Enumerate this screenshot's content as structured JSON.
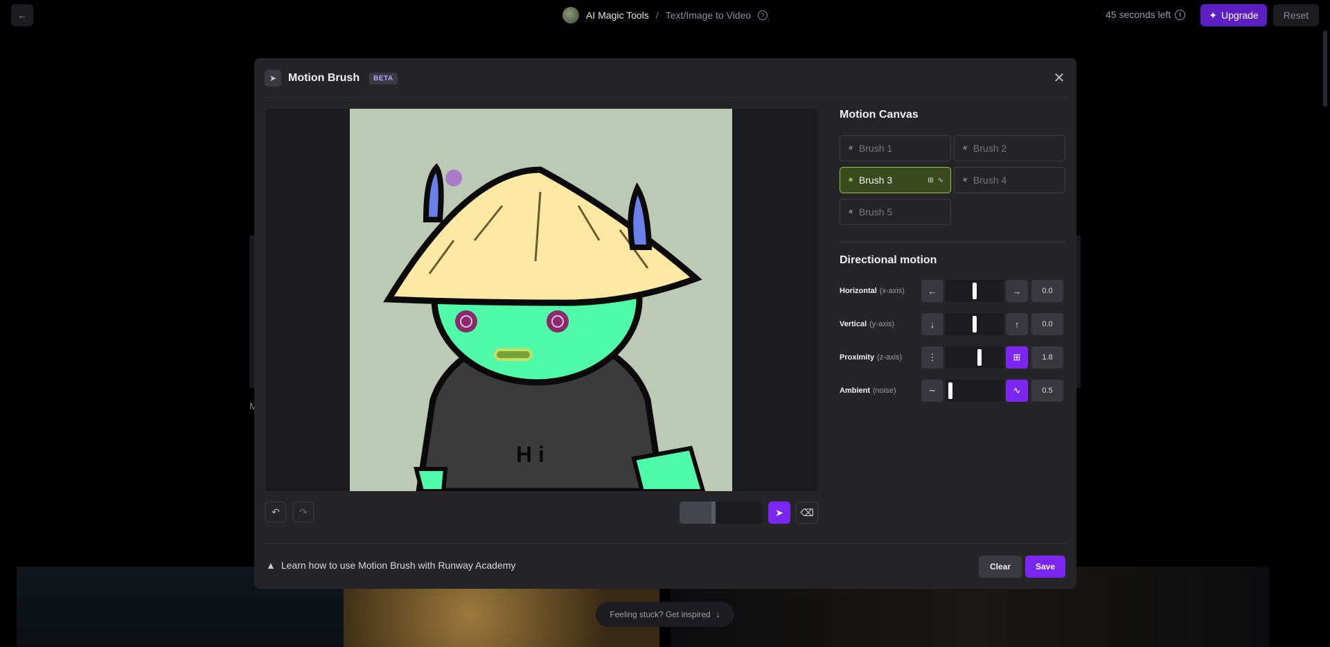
{
  "topbar": {
    "back_icon": "arrow-left-icon",
    "breadcrumb_app": "AI Magic Tools",
    "breadcrumb_sep": "/",
    "breadcrumb_page": "Text/Image to Video",
    "time_left": "45 seconds left",
    "upgrade_label": "Upgrade",
    "reset_label": "Reset"
  },
  "background": {
    "inspire_label": "Feeling stuck? Get inspired",
    "partial_letter": "M"
  },
  "modal": {
    "title": "Motion Brush",
    "badge": "BETA",
    "close_icon": "close-icon"
  },
  "motion_canvas": {
    "title": "Motion Canvas",
    "brushes": [
      {
        "label": "Brush 1",
        "active": false
      },
      {
        "label": "Brush 2",
        "active": false
      },
      {
        "label": "Brush 3",
        "active": true
      },
      {
        "label": "Brush 4",
        "active": false
      },
      {
        "label": "Brush 5",
        "active": false
      }
    ],
    "brush_size_fraction": 0.38
  },
  "directional_motion": {
    "title": "Directional motion",
    "rows": [
      {
        "label": "Horizontal",
        "sub": "(x-axis)",
        "left_icon": "arrow-left-icon",
        "right_icon": "arrow-right-icon",
        "value": "0.0",
        "level": 0.5,
        "right_accent": false
      },
      {
        "label": "Vertical",
        "sub": "(y-axis)",
        "left_icon": "arrow-down-icon",
        "right_icon": "arrow-up-icon",
        "value": "0.0",
        "level": 0.5,
        "right_accent": false
      },
      {
        "label": "Proximity",
        "sub": "(z-axis)",
        "left_icon": "proximity-far-icon",
        "right_icon": "proximity-near-icon",
        "value": "1.8",
        "level": 0.59,
        "right_accent": true
      },
      {
        "label": "Ambient",
        "sub": "(noise)",
        "left_icon": "wave-low-icon",
        "right_icon": "wave-high-icon",
        "value": "0.5",
        "level": 0.05,
        "right_accent": true
      }
    ]
  },
  "footer": {
    "academy_link": "Learn how to use Motion Brush with Runway Academy",
    "clear_label": "Clear",
    "save_label": "Save"
  },
  "colors": {
    "accent": "#7a26f0",
    "active_brush": "#8ec641",
    "upgrade": "#5b1fc4"
  }
}
